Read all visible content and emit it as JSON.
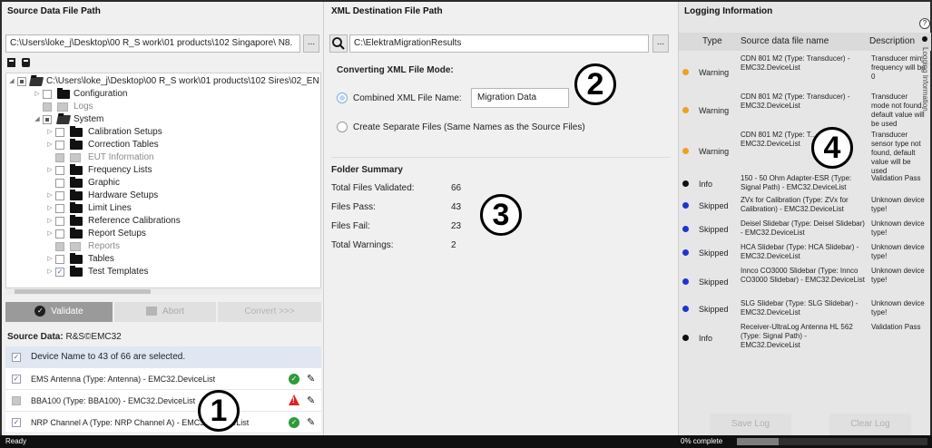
{
  "left": {
    "title": "Source Data File Path",
    "path_value": "C:\\Users\\loke_j\\Desktop\\00 R_S work\\01 products\\102 Singapore\\ N8.",
    "browse_label": "...",
    "tree": {
      "root": "C:\\Users\\loke_j\\Desktop\\00 R_S work\\01 products\\102 Sires\\02_EN",
      "items": [
        {
          "label": "Configuration"
        },
        {
          "label": "Logs"
        },
        {
          "label": "System"
        },
        {
          "label": "Calibration Setups"
        },
        {
          "label": "Correction Tables"
        },
        {
          "label": "EUT Information"
        },
        {
          "label": "Frequency Lists"
        },
        {
          "label": "Graphic"
        },
        {
          "label": "Hardware Setups"
        },
        {
          "label": "Limit Lines"
        },
        {
          "label": "Reference Calibrations"
        },
        {
          "label": "Report Setups"
        },
        {
          "label": "Reports"
        },
        {
          "label": "Tables"
        },
        {
          "label": "Test Templates"
        }
      ]
    },
    "buttons": {
      "validate": "Validate",
      "abort": "Abort",
      "convert": "Convert >>>"
    },
    "source_label": "Source Data:",
    "source_value": "R&S©EMC32",
    "list_header": "Device Name to 43 of 66 are selected.",
    "rows": [
      {
        "text": "EMS Antenna (Type: Antenna) - EMC32.DeviceList",
        "status": "ok"
      },
      {
        "text": "BBA100 (Type: BBA100) - EMC32.DeviceList",
        "status": "warn"
      },
      {
        "text": "NRP Channel A (Type: NRP Channel A) - EMC32.DeviceList",
        "status": "ok"
      }
    ]
  },
  "middle": {
    "title": "XML Destination File Path",
    "path_value": "C:\\ElektraMigrationResults",
    "browse_label": "...",
    "mode_title": "Converting XML File Mode:",
    "combined_label": "Combined XML File Name:",
    "combined_value": "Migration Data",
    "separate_label": "Create Separate Files (Same Names as the Source Files)",
    "summary_title": "Folder Summary",
    "summary": [
      {
        "label": "Total Files Validated:",
        "value": "66"
      },
      {
        "label": "Files Pass:",
        "value": "43"
      },
      {
        "label": "Files Fail:",
        "value": "23"
      },
      {
        "label": "Total Warnings:",
        "value": "2"
      }
    ]
  },
  "right": {
    "title": "Logging Information",
    "columns": {
      "type": "Type",
      "source": "Source data file name",
      "desc": "Description"
    },
    "rows": [
      {
        "type": "Warning",
        "src": "CDN 801 M2 (Type: Transducer) - EMC32.DeviceList",
        "desc": "Transducer min frequency will be 0",
        "color": "#f0a020"
      },
      {
        "type": "Warning",
        "src": "CDN 801 M2 (Type: Transducer) - EMC32.DeviceList",
        "desc": "Transducer mode not found, default value will be used",
        "color": "#f0a020"
      },
      {
        "type": "Warning",
        "src": "CDN 801 M2 (Type: T... EMC32.DeviceList",
        "desc": "Transducer sensor type not found, default value will be used",
        "color": "#f0a020"
      },
      {
        "type": "Info",
        "src": "150 - 50 Ohm Adapter-ESR (Type: Signal Path) - EMC32.DeviceList",
        "desc": "Validation Pass",
        "color": "#111111"
      },
      {
        "type": "Skipped",
        "src": "ZVx for Calibration (Type: ZVx for Calibration) - EMC32.DeviceList",
        "desc": "Unknown device type!",
        "color": "#2233cc"
      },
      {
        "type": "Skipped",
        "src": "Deisel Slidebar (Type: Deisel Slidebar) - EMC32.DeviceList",
        "desc": "Unknown device type!",
        "color": "#2233cc"
      },
      {
        "type": "Skipped",
        "src": "HCA Slidebar (Type: HCA Slidebar) - EMC32.DeviceList",
        "desc": "Unknown device type!",
        "color": "#2233cc"
      },
      {
        "type": "Skipped",
        "src": "Innco CO3000 Slidebar (Type: Innco CO3000 Slidebar) - EMC32.DeviceList",
        "desc": "Unknown device type!",
        "color": "#2233cc"
      },
      {
        "type": "Skipped",
        "src": "SLG Slidebar (Type: SLG Slidebar) - EMC32.DeviceList",
        "desc": "Unknown device type!",
        "color": "#2233cc"
      },
      {
        "type": "Info",
        "src": "Receiver-UltraLog Antenna HL 562 (Type: Signal Path) - EMC32.DeviceList",
        "desc": "Validation Pass",
        "color": "#111111"
      }
    ],
    "save_log": "Save Log",
    "clear_log": "Clear Log",
    "side_tab": "Logging Information",
    "help": "?"
  },
  "callouts": [
    "1",
    "2",
    "3",
    "4"
  ],
  "status": {
    "ready": "Ready",
    "progress_text": "0% complete",
    "progress_fraction": 0.22
  }
}
